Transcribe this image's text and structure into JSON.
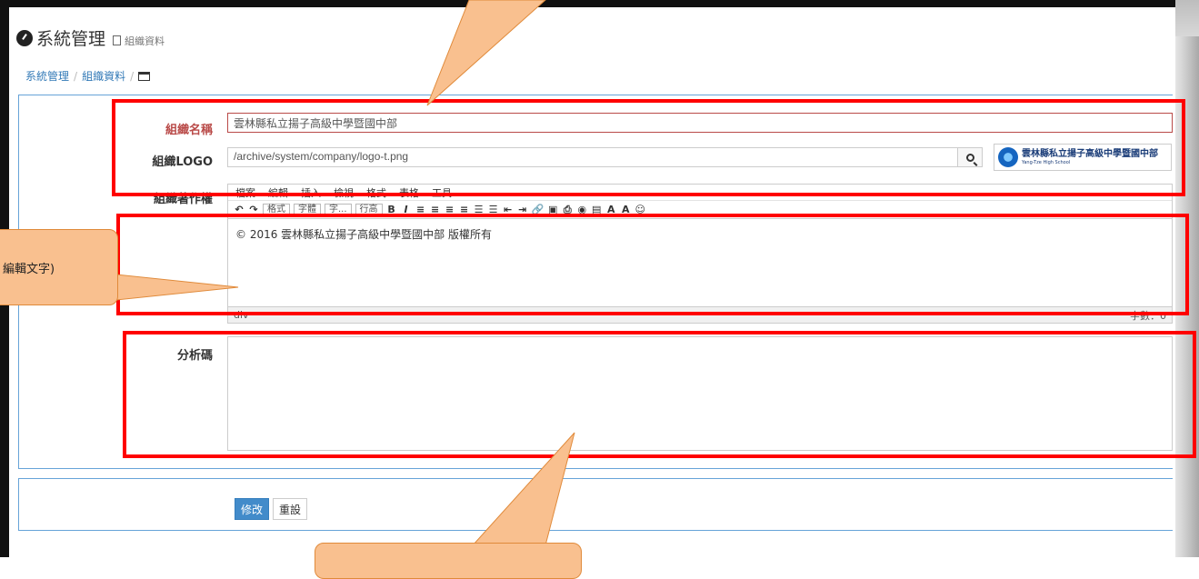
{
  "header": {
    "title": "系統管理",
    "subtitle": "組織資料"
  },
  "breadcrumb": {
    "items": [
      "系統管理",
      "組織資料"
    ],
    "separator": "/"
  },
  "form": {
    "org_name": {
      "label": "組織名稱",
      "value": "雲林縣私立揚子高級中學暨國中部"
    },
    "org_logo": {
      "label": "組織LOGO",
      "value": "/archive/system/company/logo-t.png",
      "logo_text": "雲林縣私立揚子高級中學暨國中部",
      "logo_subtext": "Yang-Tze High School"
    },
    "copyright": {
      "label": "組織著作權",
      "menu": [
        "檔案",
        "編輯",
        "插入",
        "檢視",
        "格式",
        "表格",
        "工具"
      ],
      "toolbar_selects": [
        "格式",
        "字體",
        "字...",
        "行高"
      ],
      "content": "© 2016 雲林縣私立揚子高級中學暨國中部 版權所有",
      "status_path": "div",
      "word_count": "字數：0"
    },
    "analytics": {
      "label": "分析碼",
      "value": ""
    }
  },
  "actions": {
    "submit_label": "修改",
    "reset_label": "重設"
  },
  "annotations": {
    "left_callout_text": "編輯文字)",
    "accent_color": "#ff0000",
    "callout_color": "#f9c08f"
  }
}
